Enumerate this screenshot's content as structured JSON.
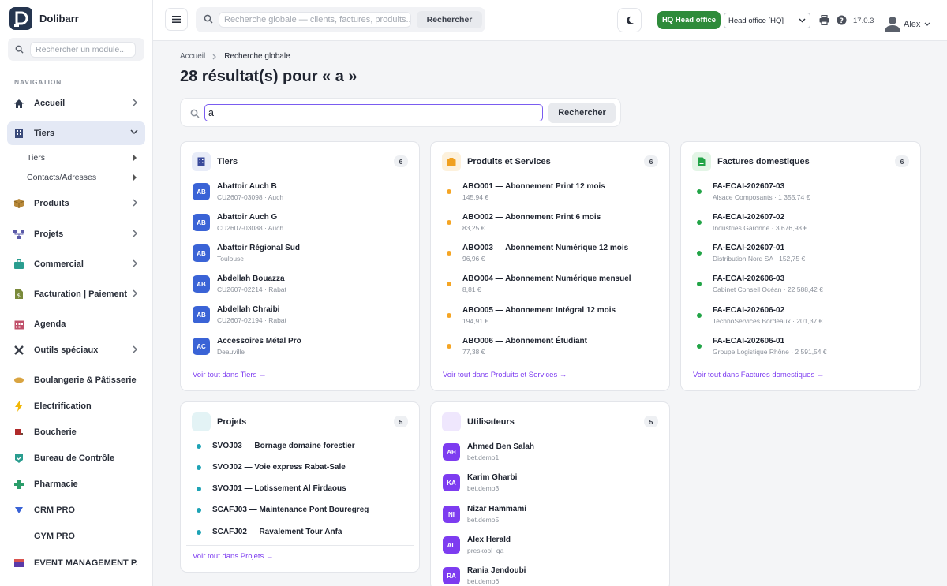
{
  "app": {
    "name": "Dolibarr"
  },
  "sidebar": {
    "search_placeholder": "Rechercher un module...",
    "section_title": "NAVIGATION",
    "items": [
      {
        "label": "Accueil",
        "icon": "home-icon"
      },
      {
        "label": "Tiers",
        "icon": "building-icon"
      },
      {
        "label": "Produits",
        "icon": "box-icon"
      },
      {
        "label": "Projets",
        "icon": "project-icon"
      },
      {
        "label": "Commercial",
        "icon": "briefcase-icon"
      },
      {
        "label": "Facturation | Paiement",
        "icon": "invoice-icon"
      },
      {
        "label": "Agenda",
        "icon": "calendar-icon"
      },
      {
        "label": "Outils spéciaux",
        "icon": "tools-icon"
      },
      {
        "label": "Boulangerie & Pâtisserie",
        "icon": "bread-icon"
      },
      {
        "label": "Electrification",
        "icon": "bolt-icon"
      },
      {
        "label": "Boucherie",
        "icon": "meat-icon"
      },
      {
        "label": "Bureau de Contrôle",
        "icon": "shield-icon"
      },
      {
        "label": "Pharmacie",
        "icon": "cross-icon"
      },
      {
        "label": "CRM PRO",
        "icon": "crm-icon"
      },
      {
        "label": "GYM PRO",
        "icon": "gym-icon"
      },
      {
        "label": "EVENT MANAGEMENT P...",
        "icon": "event-icon"
      }
    ],
    "subitems": [
      {
        "label": "Tiers"
      },
      {
        "label": "Contacts/Adresses"
      }
    ]
  },
  "topbar": {
    "search_placeholder": "Recherche globale — clients, factures, produits...",
    "search_button": "Rechercher",
    "entity_badge": "HQ Head office",
    "entity_select": "Head office [HQ]",
    "version": "17.0.3",
    "username": "Alex"
  },
  "breadcrumb": {
    "home": "Accueil",
    "current": "Recherche globale"
  },
  "page": {
    "title": "28 résultat(s) pour « a »",
    "search_value": "a",
    "search_button": "Rechercher"
  },
  "cards": {
    "tiers": {
      "title": "Tiers",
      "count": "6",
      "link": "Voir tout dans Tiers",
      "rows": [
        {
          "badge": "AB",
          "title": "Abattoir Auch B",
          "sub": "CU2607-03098 · Auch"
        },
        {
          "badge": "AB",
          "title": "Abattoir Auch G",
          "sub": "CU2607-03088 · Auch"
        },
        {
          "badge": "AB",
          "title": "Abattoir Régional Sud",
          "sub": "Toulouse"
        },
        {
          "badge": "AB",
          "title": "Abdellah Bouazza",
          "sub": "CU2607-02214 · Rabat"
        },
        {
          "badge": "AB",
          "title": "Abdellah Chraibi",
          "sub": "CU2607-02194 · Rabat"
        },
        {
          "badge": "AC",
          "title": "Accessoires Métal Pro",
          "sub": "Deauville"
        }
      ]
    },
    "produits": {
      "title": "Produits et Services",
      "count": "6",
      "link": "Voir tout dans Produits et Services",
      "rows": [
        {
          "title": "ABO001 — Abonnement Print 12 mois",
          "sub": "145,94 €"
        },
        {
          "title": "ABO002 — Abonnement Print 6 mois",
          "sub": "83,25 €"
        },
        {
          "title": "ABO003 — Abonnement Numérique 12 mois",
          "sub": "96,96 €"
        },
        {
          "title": "ABO004 — Abonnement Numérique mensuel",
          "sub": "8,81 €"
        },
        {
          "title": "ABO005 — Abonnement Intégral 12 mois",
          "sub": "194,91 €"
        },
        {
          "title": "ABO006 — Abonnement Étudiant",
          "sub": "77,38 €"
        }
      ]
    },
    "factures": {
      "title": "Factures domestiques",
      "count": "6",
      "link": "Voir tout dans Factures domestiques",
      "rows": [
        {
          "title": "FA-ECAI-202607-03",
          "sub": "Alsace Composants · 1 355,74 €"
        },
        {
          "title": "FA-ECAI-202607-02",
          "sub": "Industries Garonne · 3 676,98 €"
        },
        {
          "title": "FA-ECAI-202607-01",
          "sub": "Distribution Nord SA · 152,75 €"
        },
        {
          "title": "FA-ECAI-202606-03",
          "sub": "Cabinet Conseil Océan · 22 588,42 €"
        },
        {
          "title": "FA-ECAI-202606-02",
          "sub": "TechnoServices Bordeaux · 201,37 €"
        },
        {
          "title": "FA-ECAI-202606-01",
          "sub": "Groupe Logistique Rhône · 2 591,54 €"
        }
      ]
    },
    "projets": {
      "title": "Projets",
      "count": "5",
      "link": "Voir tout dans Projets",
      "rows": [
        {
          "title": "SVOJ03 — Bornage domaine forestier"
        },
        {
          "title": "SVOJ02 — Voie express Rabat-Sale"
        },
        {
          "title": "SVOJ01 — Lotissement Al Firdaous"
        },
        {
          "title": "SCAFJ03 — Maintenance Pont Bouregreg"
        },
        {
          "title": "SCAFJ02 — Ravalement Tour Anfa"
        }
      ]
    },
    "utilisateurs": {
      "title": "Utilisateurs",
      "count": "5",
      "rows": [
        {
          "badge": "AH",
          "title": "Ahmed Ben Salah",
          "sub": "bet.demo1"
        },
        {
          "badge": "KA",
          "title": "Karim Gharbi",
          "sub": "bet.demo3"
        },
        {
          "badge": "NI",
          "title": "Nizar Hammami",
          "sub": "bet.demo5"
        },
        {
          "badge": "AL",
          "title": "Alex Herald",
          "sub": "preskool_qa"
        },
        {
          "badge": "RA",
          "title": "Rania Jendoubi",
          "sub": "bet.demo6"
        }
      ]
    }
  },
  "colors": {
    "accent": "#7d3cf0",
    "tiers_badge": "#3a63d6",
    "product_dot": "#f5a524",
    "invoice_dot": "#22a447",
    "project_dot": "#1ea3b5",
    "entity_green": "#2e8b3a"
  }
}
